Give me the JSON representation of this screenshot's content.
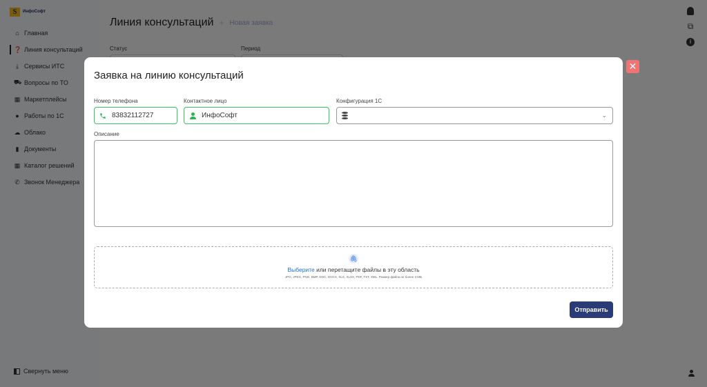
{
  "app": {
    "logo_text": "ИнфоСофт"
  },
  "sidebar": {
    "items": [
      {
        "label": "Главная",
        "icon": "home-icon"
      },
      {
        "label": "Линия консультаций",
        "icon": "question-icon"
      },
      {
        "label": "Сервисы ИТС",
        "icon": "download-icon"
      },
      {
        "label": "Вопросы по ТО",
        "icon": "cart-icon"
      },
      {
        "label": "Маркетплейсы",
        "icon": "store-icon"
      },
      {
        "label": "Работы по 1С",
        "icon": "users-icon"
      },
      {
        "label": "Облако",
        "icon": "cloud-icon"
      },
      {
        "label": "Документы",
        "icon": "document-icon"
      },
      {
        "label": "Каталог решений",
        "icon": "grid-icon"
      },
      {
        "label": "Звонок Менеджера",
        "icon": "phone-icon"
      }
    ],
    "collapse_label": "Свернуть меню"
  },
  "header": {
    "title": "Линия консультаций",
    "breadcrumb": "Новая заявка"
  },
  "filters": {
    "status_label": "Статус",
    "period_label": "Период"
  },
  "modal": {
    "title": "Заявка на линию консультаций",
    "phone_label": "Номер телефона",
    "phone_value": "83832112727",
    "contact_label": "Контактное лицо",
    "contact_value": "ИнфоСофт",
    "config_label": "Конфигурация 1С",
    "config_value": "",
    "description_label": "Описание",
    "description_value": "",
    "upload_link": "Выберите",
    "upload_text": " или перетащите файлы в эту область",
    "upload_hint": "JPG, JPEG, PNG, BMP, DOC, DOCX, XLS, XLSX, PDF, TXT, XML. Размер файла не более 3 МБ",
    "submit_label": "Отправить"
  }
}
